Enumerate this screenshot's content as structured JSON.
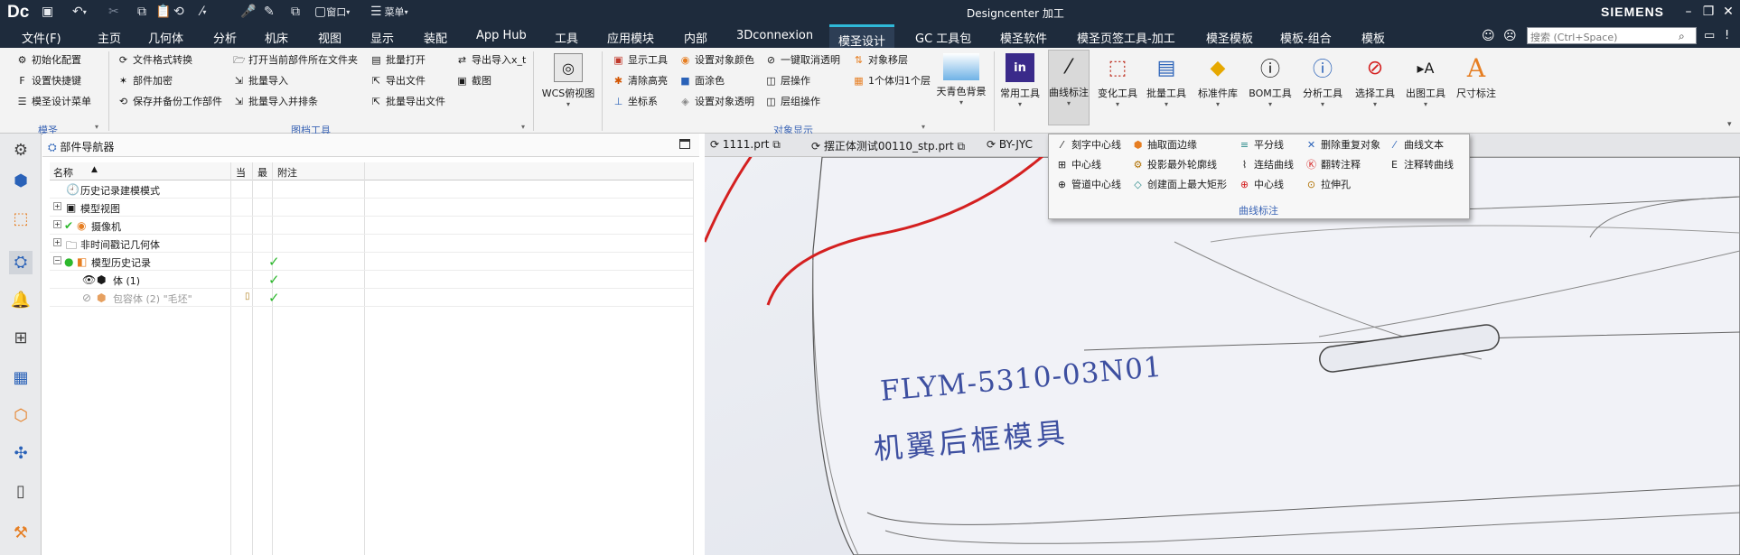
{
  "titlebar": {
    "logo": "Dc",
    "app_title": "Designcenter 加工",
    "brand": "SIEMENS",
    "window_menu_label": "窗口",
    "menu_label": "菜单"
  },
  "menubar": {
    "items": [
      "文件(F)",
      "主页",
      "几何体",
      "分析",
      "机床",
      "视图",
      "显示",
      "装配",
      "App Hub",
      "工具",
      "应用模块",
      "内部",
      "3Dconnexion",
      "模圣设计",
      "GC 工具包",
      "模圣软件",
      "模圣页签工具-加工",
      "模圣模板",
      "模板-组合",
      "模板"
    ],
    "selected": "模圣设计",
    "search_placeholder": "搜索 (Ctrl+Space)"
  },
  "ribbon": {
    "group1": {
      "items": [
        "初始化配置",
        "设置快捷键",
        "模圣设计菜单"
      ],
      "label": "模圣"
    },
    "group2": {
      "col1": [
        "文件格式转换",
        "部件加密",
        "保存并备份工作部件"
      ],
      "col2": [
        "打开当前部件所在文件夹",
        "批量导入",
        "批量导入并排条"
      ],
      "col3": [
        "批量打开",
        "导出文件",
        "批量导出文件"
      ],
      "col4": [
        "导出导入x_t",
        "截图"
      ],
      "label": "图档工具"
    },
    "wcs": "WCS俯视图",
    "group3": {
      "col1": [
        "显示工具",
        "清除高亮",
        "坐标系"
      ],
      "col2": [
        "设置对象颜色",
        "面涂色",
        "设置对象透明"
      ],
      "col3": [
        "一键取消透明",
        "层操作",
        "层组操作"
      ],
      "col4": [
        "对象移层",
        "1个体归1个层"
      ],
      "label": "对象显示"
    },
    "big_buttons": [
      "天青色背景",
      "常用工具",
      "曲线标注",
      "变化工具",
      "批量工具",
      "标准件库",
      "BOM工具",
      "分析工具",
      "选择工具",
      "出图工具",
      "尺寸标注"
    ]
  },
  "navigator": {
    "title": "部件导航器",
    "columns": [
      "名称",
      "当",
      "最",
      "附注"
    ],
    "rows": [
      {
        "label": "历史记录建模模式",
        "expand": "",
        "current": "",
        "latest": false
      },
      {
        "label": "模型视图",
        "expand": "+",
        "current": "",
        "latest": false
      },
      {
        "label": "摄像机",
        "expand": "+",
        "current": "",
        "latest": false
      },
      {
        "label": "非时间戳记几何体",
        "expand": "+",
        "current": "",
        "latest": false
      },
      {
        "label": "模型历史记录",
        "expand": "−",
        "current": "",
        "latest": true
      },
      {
        "label": "体 (1)",
        "expand": "",
        "current": "",
        "latest": true
      },
      {
        "label": "包容体 (2) \"毛坯\"",
        "expand": "",
        "current": "锁",
        "latest": true
      }
    ]
  },
  "doc_tabs": [
    "1111.prt",
    "摆正体测试00110_stp.prt",
    "BY-JYC"
  ],
  "popup": {
    "col1": [
      "刻字中心线",
      "中心线",
      "管道中心线"
    ],
    "col2": [
      "抽取面边缘",
      "投影最外轮廓线",
      "创建面上最大矩形"
    ],
    "col3": [
      "平分线",
      "连结曲线",
      "中心线"
    ],
    "col4": [
      "删除重复对象",
      "翻转注释",
      "拉伸孔"
    ],
    "col5": [
      "曲线文本",
      "注释转曲线"
    ],
    "label": "曲线标注"
  },
  "model": {
    "part_number": "FLYM-5310-03N01",
    "engraved_text": "机翼后框模具"
  },
  "colors": {
    "titlebar": "#1e2b3c",
    "accent": "#2fb9d8",
    "model_text": "#3d4fa0",
    "annotation": "#d42020"
  }
}
